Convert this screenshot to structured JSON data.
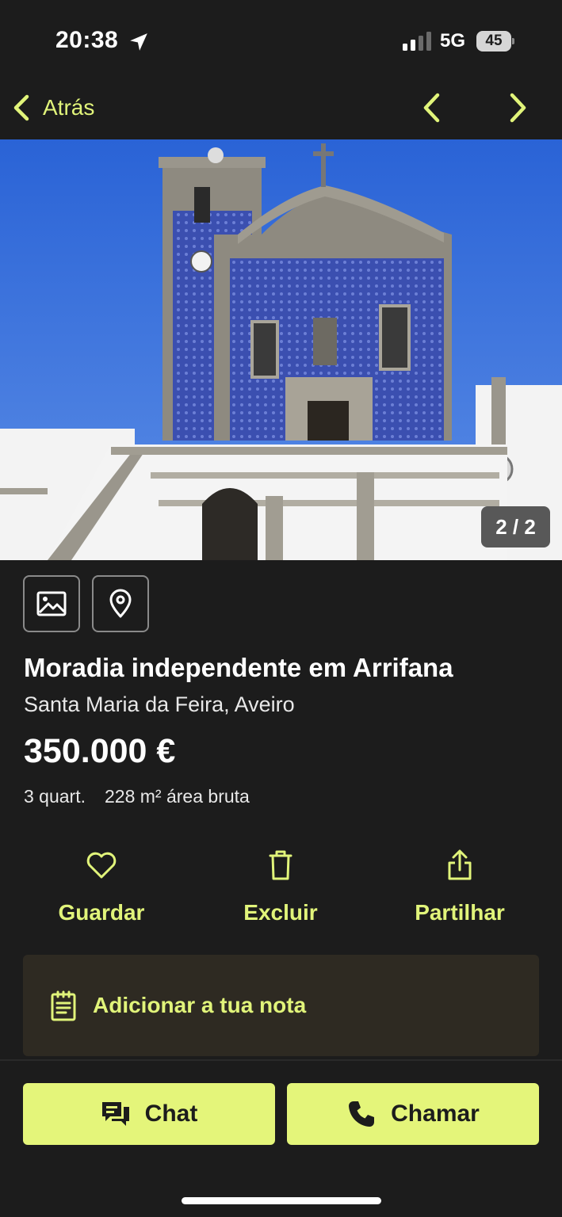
{
  "status_bar": {
    "time": "20:38",
    "network": "5G",
    "battery": "45"
  },
  "nav": {
    "back_label": "Atrás"
  },
  "gallery": {
    "counter": "2 / 2"
  },
  "listing": {
    "title": "Moradia independente em Arrifana",
    "location": "Santa Maria da Feira, Aveiro",
    "price": "350.000 €",
    "rooms": "3 quart.",
    "area": "228 m² área bruta"
  },
  "actions": {
    "save": "Guardar",
    "delete": "Excluir",
    "share": "Partilhar"
  },
  "note": {
    "label": "Adicionar a tua nota"
  },
  "cta": {
    "chat": "Chat",
    "call": "Chamar"
  },
  "colors": {
    "accent": "#e1f47a",
    "background": "#1c1c1c",
    "note_bg": "#2e2a22"
  },
  "icons": {
    "location_arrow": "location-arrow-icon",
    "back": "chevron-left-icon",
    "next": "chevron-right-icon",
    "photos": "image-icon",
    "map": "map-pin-icon",
    "save": "heart-icon",
    "delete": "trash-icon",
    "share": "share-icon",
    "note": "notepad-icon",
    "chat": "chat-bubbles-icon",
    "call": "phone-icon"
  }
}
